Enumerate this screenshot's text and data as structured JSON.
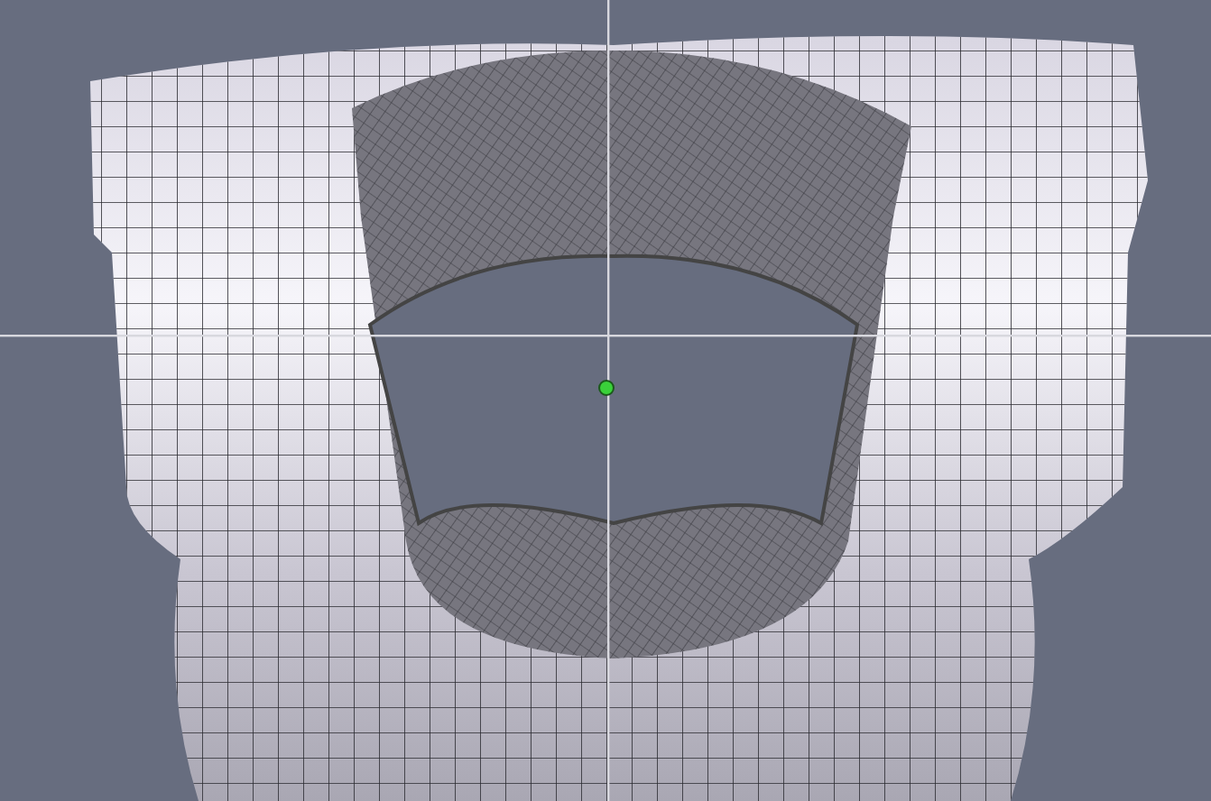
{
  "viewport": {
    "crosshair": true,
    "pivot": true
  }
}
